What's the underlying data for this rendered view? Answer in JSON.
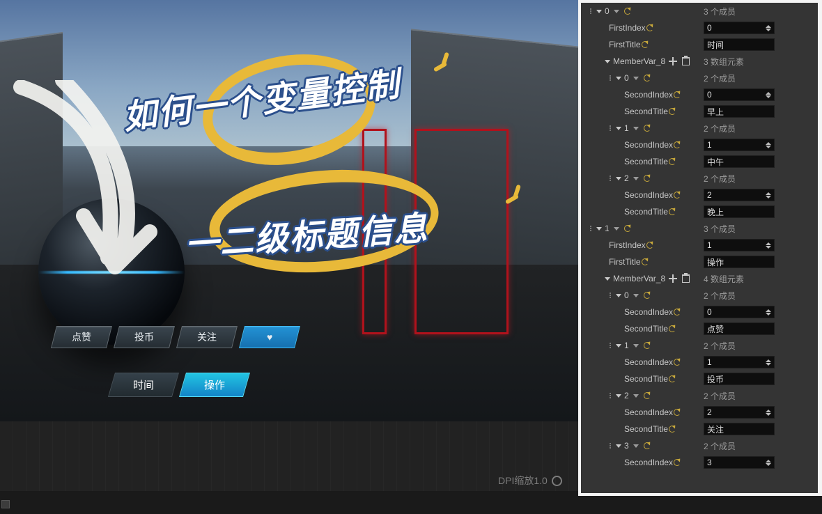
{
  "annotations": {
    "line1": "如何一个变量控制",
    "line2": "一二级标题信息"
  },
  "preview": {
    "buttons": [
      "点赞",
      "投币",
      "关注",
      "♥"
    ],
    "tabs": [
      "时间",
      "操作"
    ],
    "active_tab": 1
  },
  "footer": {
    "dpi_label": "DPI缩放1.0"
  },
  "strings": {
    "firstIndex": "FirstIndex",
    "firstTitle": "FirstTitle",
    "memberVar": "MemberVar_8",
    "secondIndex": "SecondIndex",
    "secondTitle": "SecondTitle",
    "members_suffix": "个成员",
    "array_elems_suffix": "数组元素"
  },
  "inspector": [
    {
      "idx": "0",
      "members": 3,
      "FirstIndex": 0,
      "FirstTitle": "时间",
      "memberVar": {
        "count": 3,
        "items": [
          {
            "idx": "0",
            "members": 2,
            "SecondIndex": 0,
            "SecondTitle": "早上"
          },
          {
            "idx": "1",
            "members": 2,
            "SecondIndex": 1,
            "SecondTitle": "中午"
          },
          {
            "idx": "2",
            "members": 2,
            "SecondIndex": 2,
            "SecondTitle": "晚上"
          }
        ]
      }
    },
    {
      "idx": "1",
      "members": 3,
      "FirstIndex": 1,
      "FirstTitle": "操作",
      "memberVar": {
        "count": 4,
        "items": [
          {
            "idx": "0",
            "members": 2,
            "SecondIndex": 0,
            "SecondTitle": "点赞"
          },
          {
            "idx": "1",
            "members": 2,
            "SecondIndex": 1,
            "SecondTitle": "投币"
          },
          {
            "idx": "2",
            "members": 2,
            "SecondIndex": 2,
            "SecondTitle": "关注"
          },
          {
            "idx": "3",
            "members": 2,
            "SecondIndex": 3,
            "SecondTitle": ""
          }
        ]
      }
    }
  ]
}
